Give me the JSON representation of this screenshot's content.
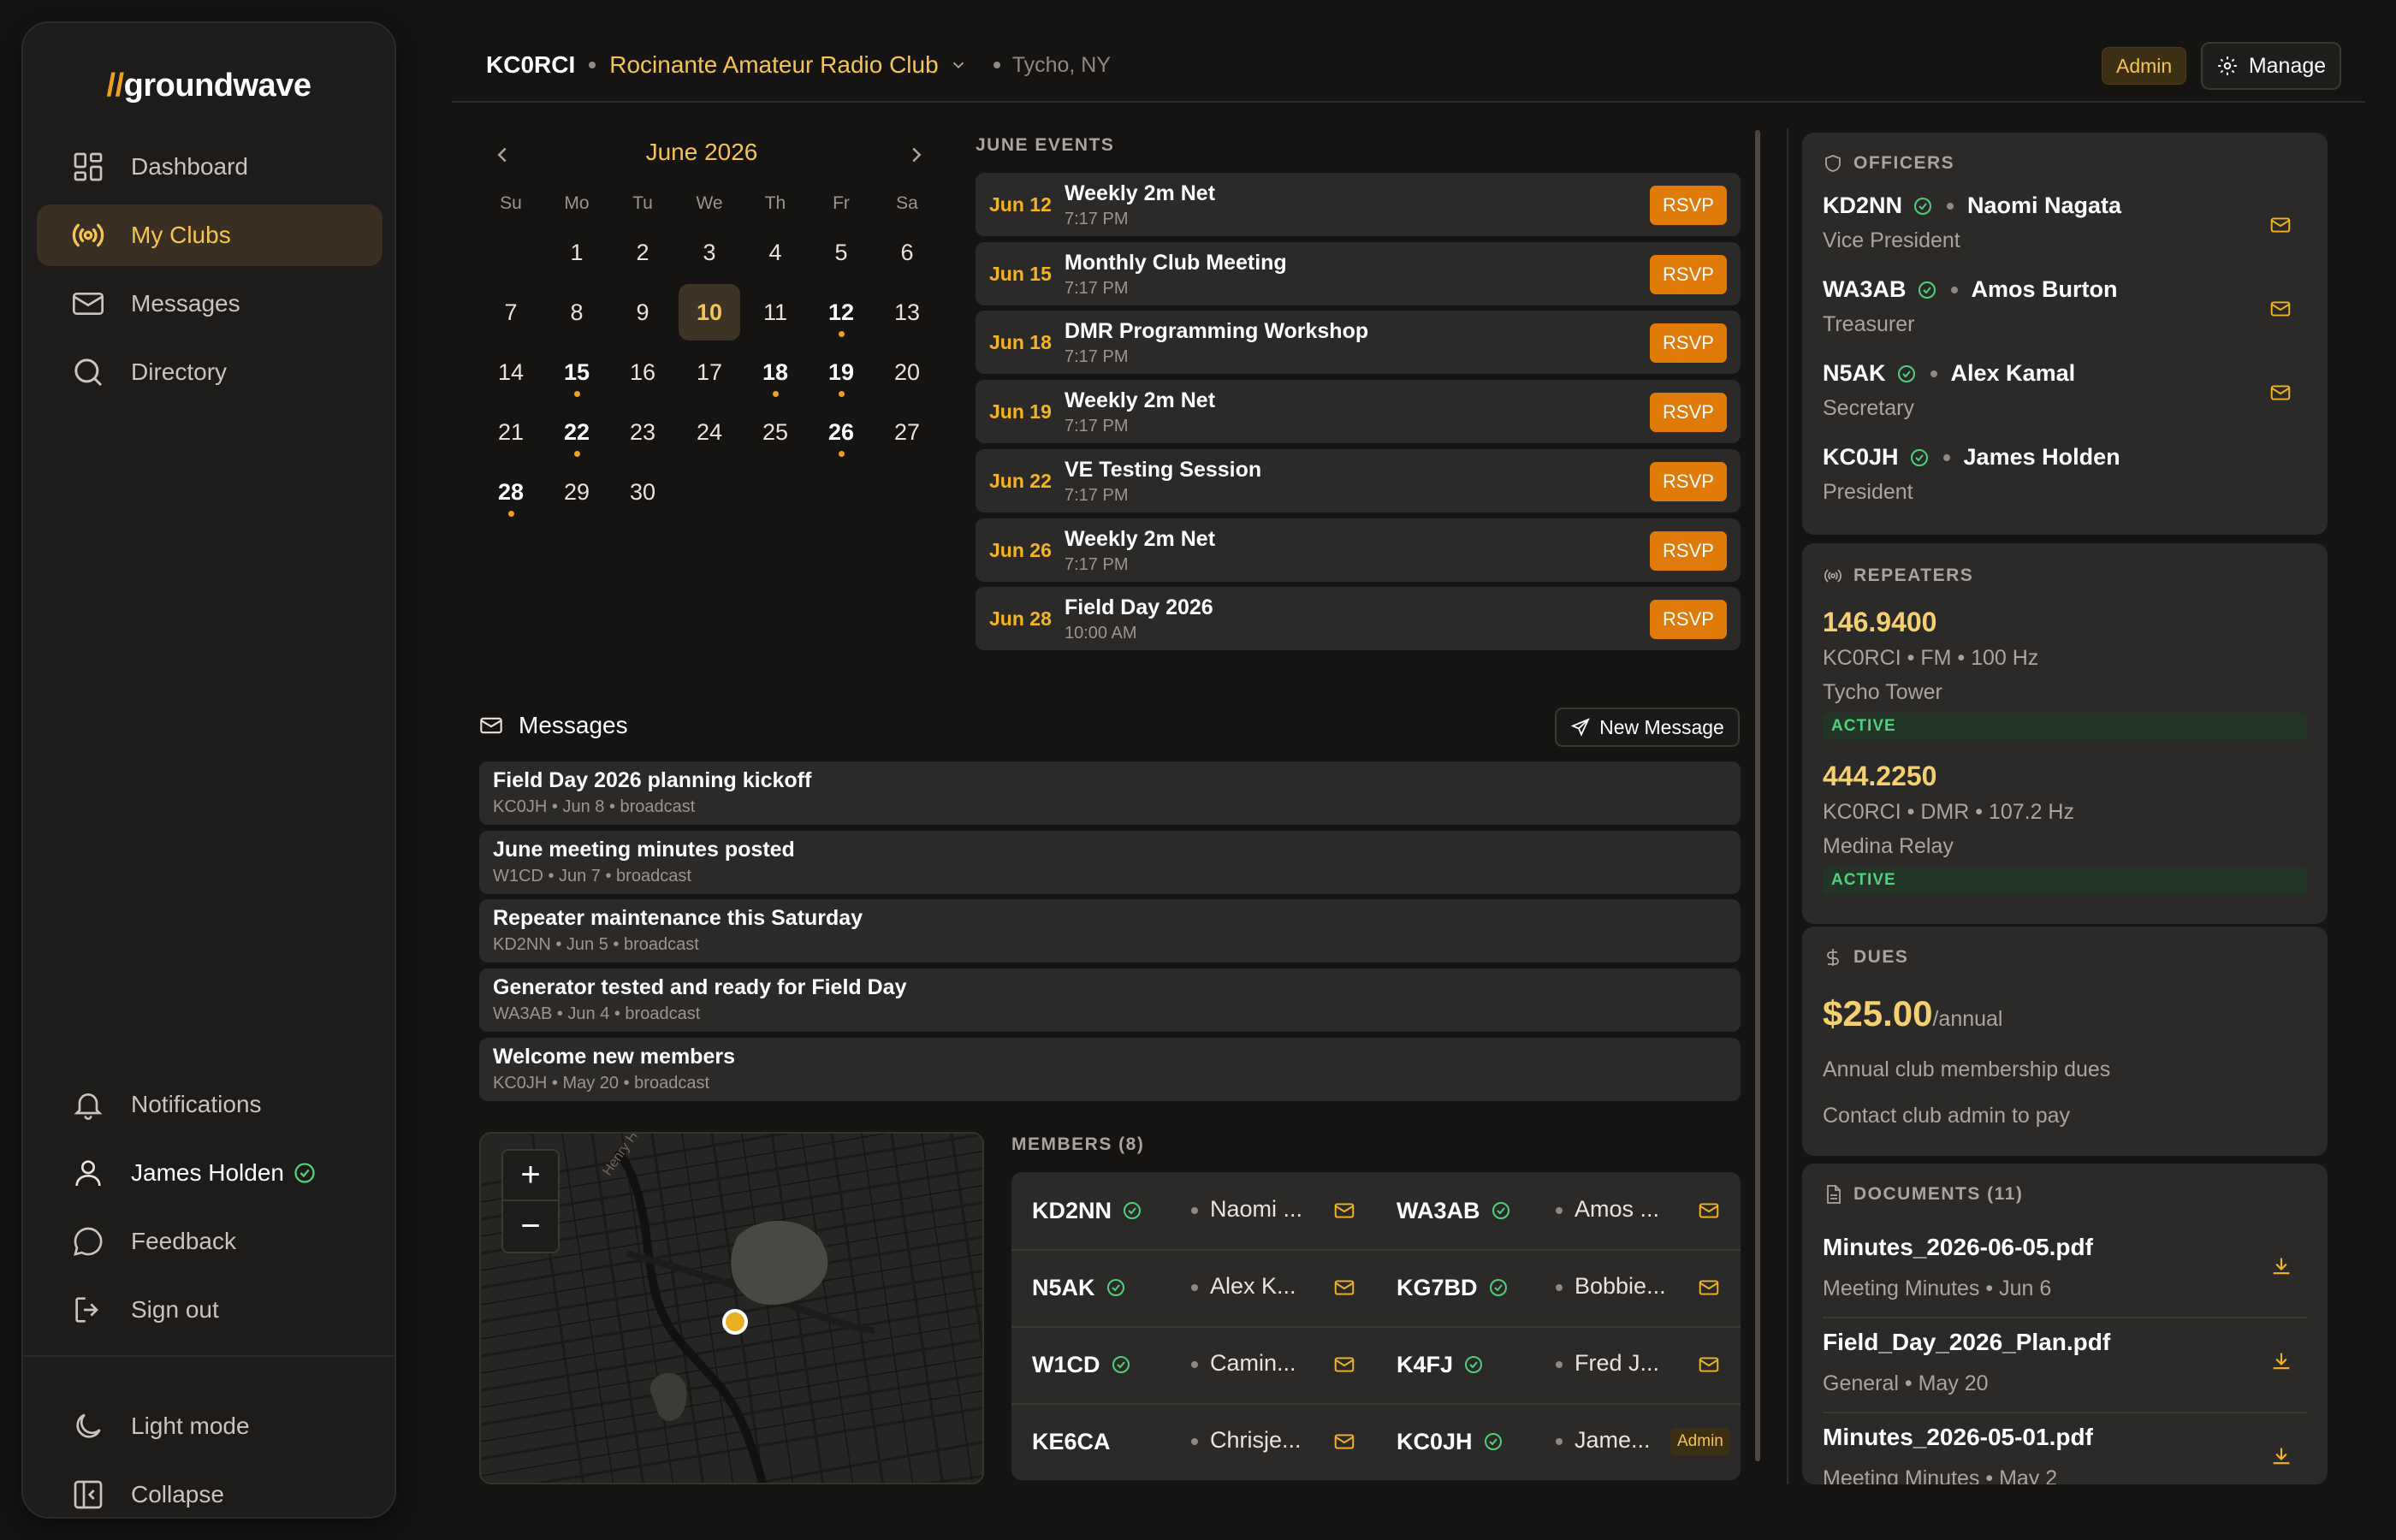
{
  "app": {
    "logo_prefix": "//",
    "logo_name": "groundwave"
  },
  "sidebar": {
    "items": [
      {
        "label": "Dashboard",
        "icon": "dashboard-icon"
      },
      {
        "label": "My Clubs",
        "icon": "radio-icon"
      },
      {
        "label": "Messages",
        "icon": "mail-icon"
      },
      {
        "label": "Directory",
        "icon": "search-icon"
      }
    ],
    "bottom": {
      "notifications": "Notifications",
      "user": "James Holden",
      "feedback": "Feedback",
      "signout": "Sign out",
      "light_mode": "Light mode",
      "collapse": "Collapse"
    }
  },
  "header": {
    "callsign": "KC0RCI",
    "club": "Rocinante Amateur Radio Club",
    "location": "Tycho, NY",
    "admin_badge": "Admin",
    "manage_label": "Manage"
  },
  "calendar": {
    "month_label": "June 2026",
    "dow": [
      "Su",
      "Mo",
      "Tu",
      "We",
      "Th",
      "Fr",
      "Sa"
    ],
    "weeks": [
      [
        "",
        "1",
        "2",
        "3",
        "4",
        "5",
        "6"
      ],
      [
        "7",
        "8",
        "9",
        "10",
        "11",
        "12",
        "13"
      ],
      [
        "14",
        "15",
        "16",
        "17",
        "18",
        "19",
        "20"
      ],
      [
        "21",
        "22",
        "23",
        "24",
        "25",
        "26",
        "27"
      ],
      [
        "28",
        "29",
        "30",
        "",
        "",
        "",
        ""
      ]
    ],
    "today": "10",
    "event_days": [
      "12",
      "15",
      "18",
      "19",
      "22",
      "26",
      "28"
    ]
  },
  "events": {
    "label": "JUNE EVENTS",
    "rsvp_label": "RSVP",
    "items": [
      {
        "date": "Jun 12",
        "title": "Weekly 2m Net",
        "time": "7:17 PM"
      },
      {
        "date": "Jun 15",
        "title": "Monthly Club Meeting",
        "time": "7:17 PM"
      },
      {
        "date": "Jun 18",
        "title": "DMR Programming Workshop",
        "time": "7:17 PM"
      },
      {
        "date": "Jun 19",
        "title": "Weekly 2m Net",
        "time": "7:17 PM"
      },
      {
        "date": "Jun 22",
        "title": "VE Testing Session",
        "time": "7:17 PM"
      },
      {
        "date": "Jun 26",
        "title": "Weekly 2m Net",
        "time": "7:17 PM"
      },
      {
        "date": "Jun 28",
        "title": "Field Day 2026",
        "time": "10:00 AM"
      }
    ]
  },
  "messages": {
    "title": "Messages",
    "new_label": "New Message",
    "items": [
      {
        "title": "Field Day 2026 planning kickoff",
        "meta": "KC0JH • Jun 8 • broadcast"
      },
      {
        "title": "June meeting minutes posted",
        "meta": "W1CD • Jun 7 • broadcast"
      },
      {
        "title": "Repeater maintenance this Saturday",
        "meta": "KD2NN • Jun 5 • broadcast"
      },
      {
        "title": "Generator tested and ready for Field Day",
        "meta": "WA3AB • Jun 4 • broadcast"
      },
      {
        "title": "Welcome new members",
        "meta": "KC0JH • May 20 • broadcast"
      }
    ]
  },
  "map": {
    "zoom_in": "+",
    "zoom_out": "−",
    "street_label": "Henry Hud"
  },
  "members": {
    "label": "MEMBERS (8)",
    "admin_badge": "Admin",
    "items": [
      {
        "call": "KD2NN",
        "name": "Naomi ...",
        "verified": true
      },
      {
        "call": "WA3AB",
        "name": "Amos ...",
        "verified": true
      },
      {
        "call": "N5AK",
        "name": "Alex K...",
        "verified": true
      },
      {
        "call": "KG7BD",
        "name": "Bobbie...",
        "verified": true
      },
      {
        "call": "W1CD",
        "name": "Camin...",
        "verified": true
      },
      {
        "call": "K4FJ",
        "name": "Fred J...",
        "verified": true
      },
      {
        "call": "KE6CA",
        "name": "Chrisje...",
        "verified": false
      },
      {
        "call": "KC0JH",
        "name": "Jame...",
        "verified": true,
        "admin": true
      }
    ]
  },
  "officers": {
    "label": "OFFICERS",
    "items": [
      {
        "call": "KD2NN",
        "name": "Naomi Nagata",
        "role": "Vice President"
      },
      {
        "call": "WA3AB",
        "name": "Amos Burton",
        "role": "Treasurer"
      },
      {
        "call": "N5AK",
        "name": "Alex Kamal",
        "role": "Secretary"
      },
      {
        "call": "KC0JH",
        "name": "James Holden",
        "role": "President"
      }
    ]
  },
  "repeaters": {
    "label": "REPEATERS",
    "items": [
      {
        "freq": "146.9400",
        "info": "KC0RCI • FM • 100 Hz",
        "location": "Tycho Tower",
        "status": "ACTIVE"
      },
      {
        "freq": "444.2250",
        "info": "KC0RCI • DMR • 107.2 Hz",
        "location": "Medina Relay",
        "status": "ACTIVE"
      }
    ]
  },
  "dues": {
    "label": "DUES",
    "amount": "$25.00",
    "period": "/annual",
    "description": "Annual club membership dues",
    "note": "Contact club admin to pay"
  },
  "documents": {
    "label": "DOCUMENTS (11)",
    "items": [
      {
        "name": "Minutes_2026-06-05.pdf",
        "meta": "Meeting Minutes • Jun 6"
      },
      {
        "name": "Field_Day_2026_Plan.pdf",
        "meta": "General • May 20"
      },
      {
        "name": "Minutes_2026-05-01.pdf",
        "meta": "Meeting Minutes • May 2"
      }
    ]
  },
  "colors": {
    "accent": "#f5c451",
    "button": "#e07a08",
    "background": "#151413",
    "panel": "#2c2a28",
    "active": "#4fd07a"
  }
}
